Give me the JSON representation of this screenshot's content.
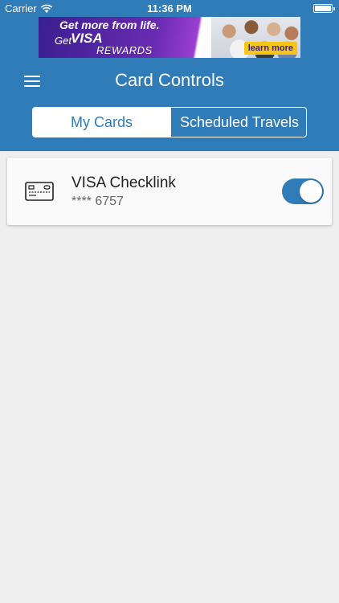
{
  "status_bar": {
    "carrier": "Carrier",
    "time": "11:36 PM",
    "battery_level": 1.0
  },
  "ad": {
    "headline": "Get more from life.",
    "get": "Get",
    "visa": "VISA",
    "rewards": "REWARDS",
    "cta": "learn more"
  },
  "nav": {
    "title": "Card Controls",
    "menu_icon": "hamburger-menu-icon"
  },
  "tabs": [
    {
      "label": "My Cards",
      "active": true
    },
    {
      "label": "Scheduled Travels",
      "active": false
    }
  ],
  "cards": [
    {
      "name": "VISA Checklink",
      "number": "**** 6757",
      "enabled": true,
      "icon": "credit-card-icon"
    }
  ],
  "colors": {
    "primary": "#2f7cb8",
    "background": "#efefef",
    "card": "#fafafa"
  }
}
